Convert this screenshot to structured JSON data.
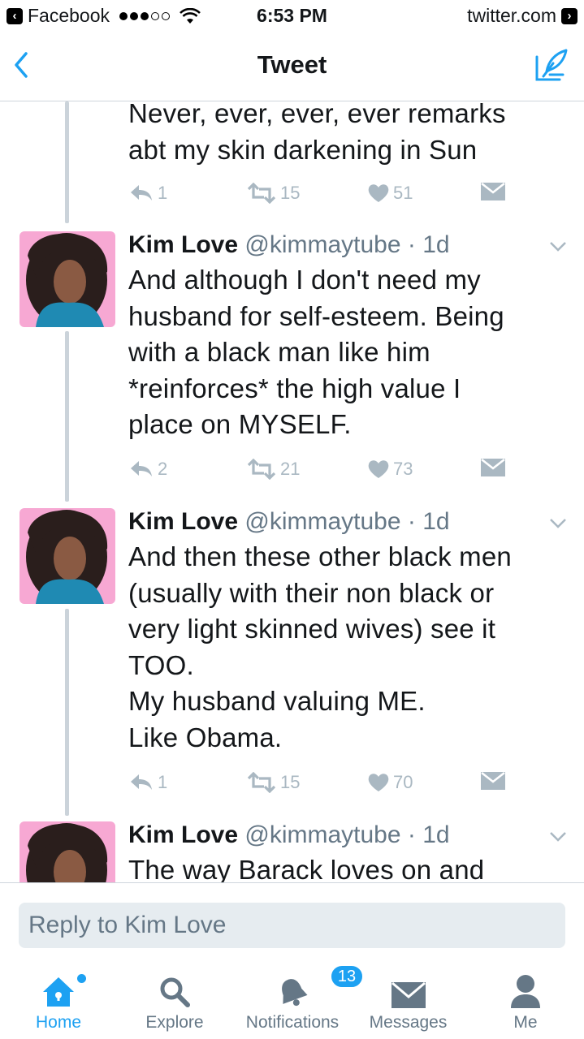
{
  "status_bar": {
    "back_app": "Facebook",
    "time": "6:53 PM",
    "site": "twitter.com"
  },
  "nav": {
    "title": "Tweet",
    "back_icon": "chevron-left-icon",
    "compose_icon": "compose-feather-icon"
  },
  "tweets": [
    {
      "partial": true,
      "text": "Never, ever, ever, ever remarks\nabt my skin darkening in Sun",
      "replies": "1",
      "retweets": "15",
      "likes": "51"
    },
    {
      "name": "Kim Love",
      "handle": "@kimmaytube",
      "time": "· 1d",
      "text": "And although I don't need my\nhusband for self-esteem. Being\nwith a black man like him\n*reinforces* the high value I\nplace on MYSELF.",
      "replies": "2",
      "retweets": "21",
      "likes": "73"
    },
    {
      "name": "Kim Love",
      "handle": "@kimmaytube",
      "time": "· 1d",
      "text": "And then these other black men\n(usually with their non black or\nvery light skinned wives) see it\nTOO.\nMy husband valuing ME.\nLike Obama.",
      "replies": "1",
      "retweets": "15",
      "likes": "70"
    },
    {
      "name": "Kim Love",
      "handle": "@kimmaytube",
      "time": "· 1d",
      "text": "The way Barack loves on and"
    }
  ],
  "reply": {
    "placeholder": "Reply to Kim Love"
  },
  "tabs": [
    {
      "label": "Home",
      "icon": "home-icon",
      "active": true
    },
    {
      "label": "Explore",
      "icon": "search-icon"
    },
    {
      "label": "Notifications",
      "icon": "bell-icon",
      "badge": "13"
    },
    {
      "label": "Messages",
      "icon": "envelope-icon"
    },
    {
      "label": "Me",
      "icon": "person-icon"
    }
  ],
  "colors": {
    "accent": "#1da1f2",
    "text": "#14171a",
    "muted": "#657786",
    "action_gray": "#aab8c2",
    "avatar_bg": "#f7a8d3"
  }
}
